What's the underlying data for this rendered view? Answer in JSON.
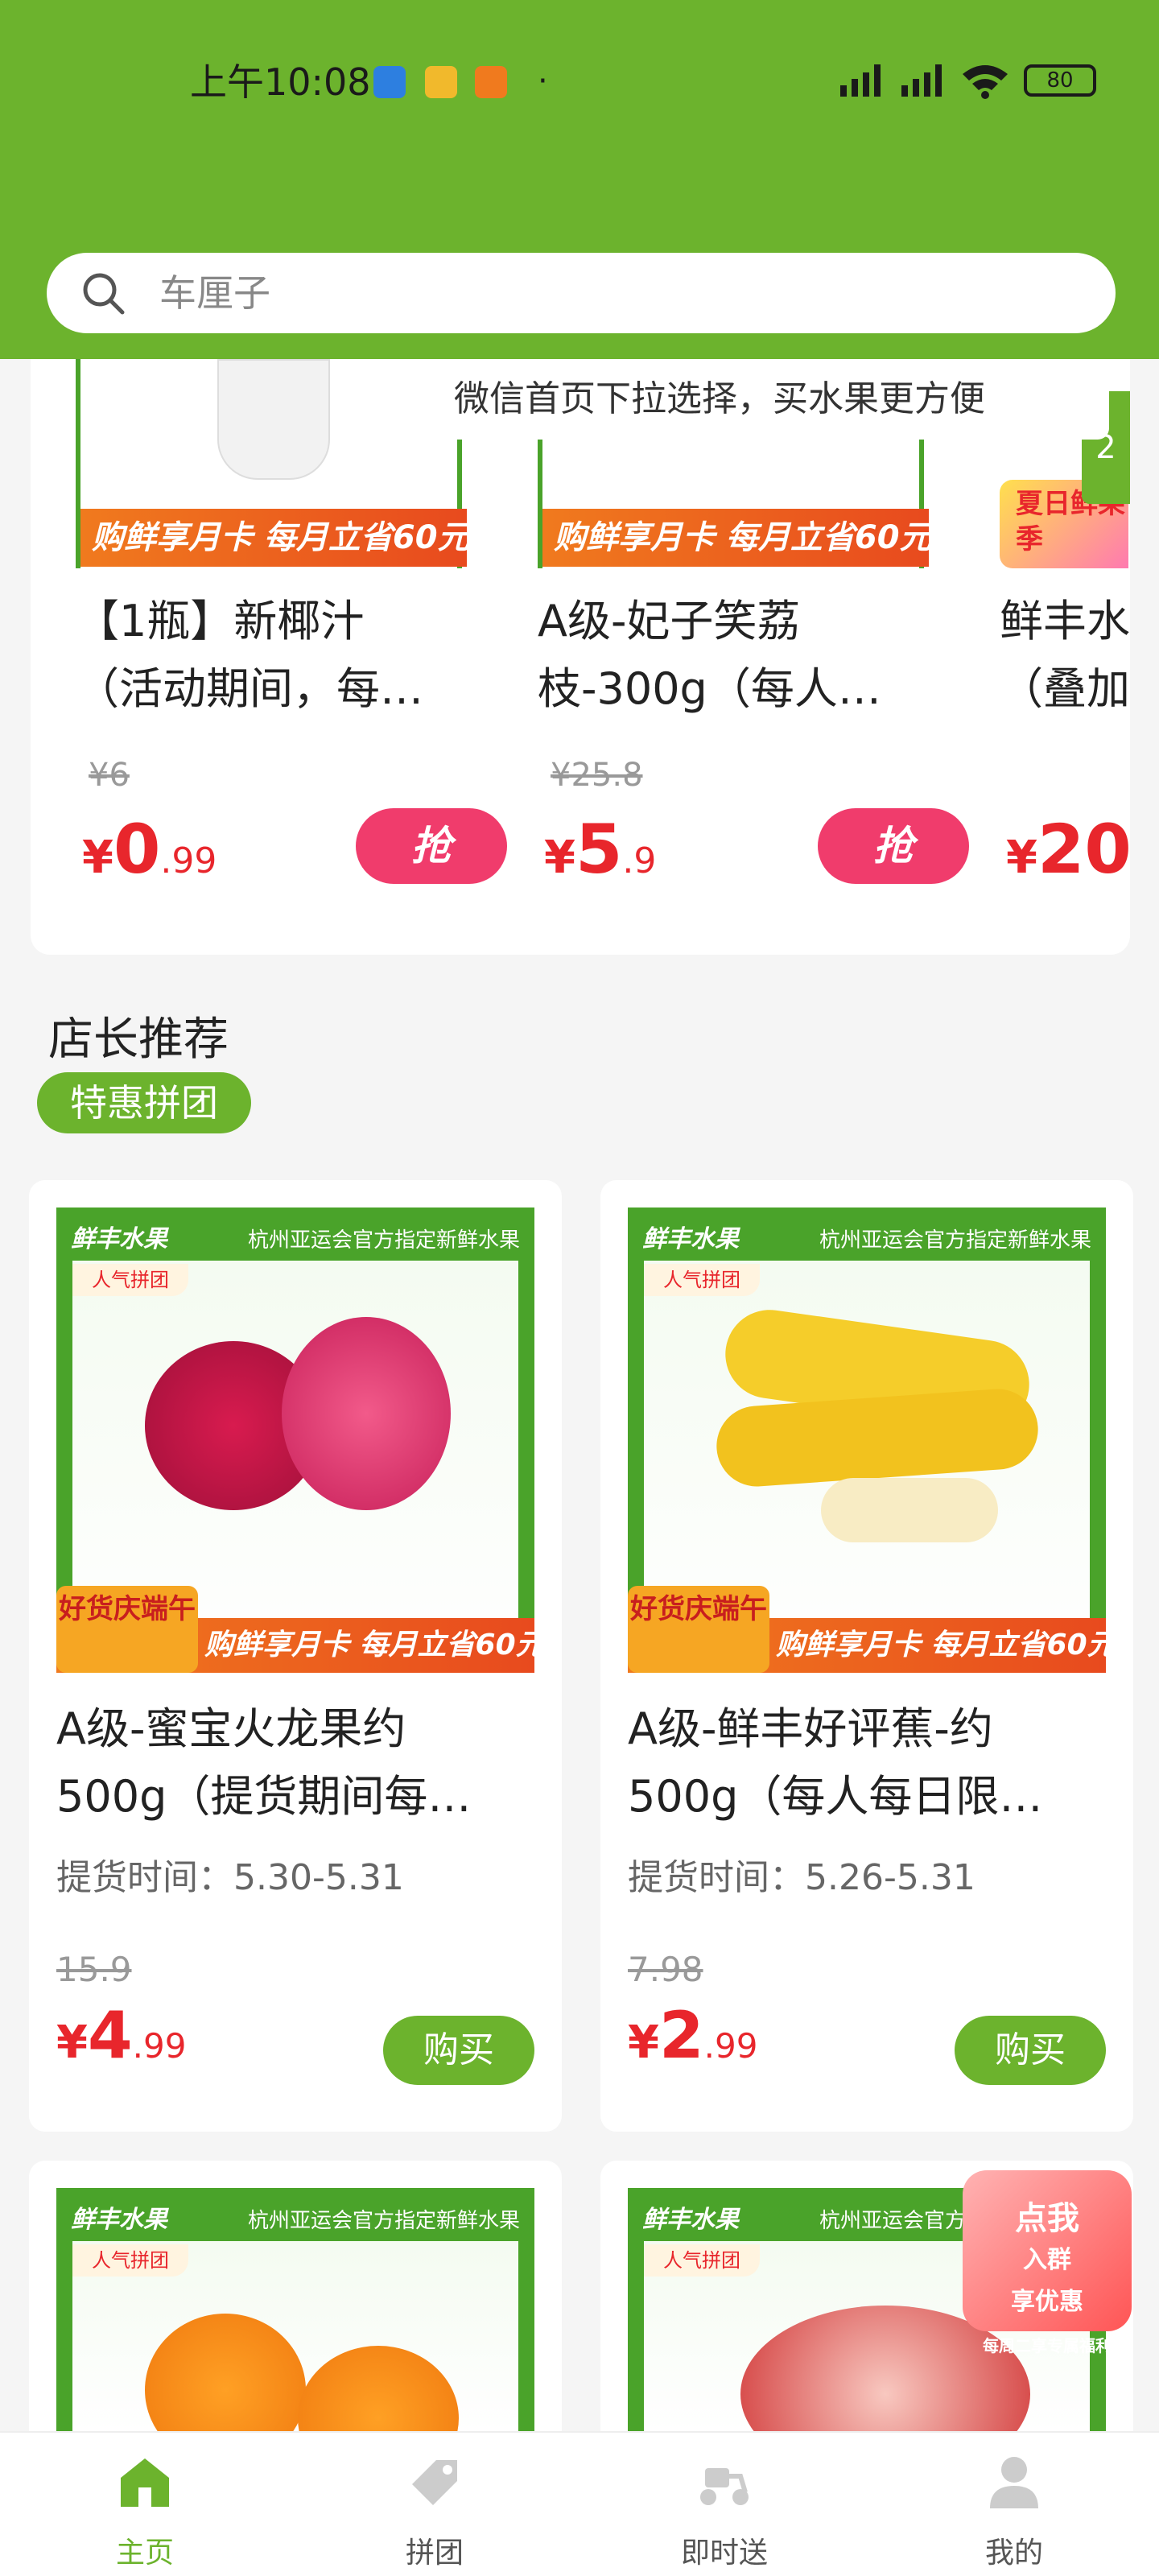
{
  "status_bar": {
    "time": "上午10:08",
    "battery": "80"
  },
  "search": {
    "placeholder": "车厘子"
  },
  "tip": "微信首页下拉选择，买水果更方便",
  "strip_items": [
    {
      "name_line1": "【1瓶】新椰汁",
      "name_line2": "（活动期间，每…",
      "banner": "购鲜享月卡 每月立省60元",
      "original_price": "¥6",
      "price_currency": "¥",
      "price_int": "0",
      "price_dec": ".99",
      "button": "抢"
    },
    {
      "name_line1": "A级-妃子笑荔",
      "name_line2": "枝-300g（每人…",
      "banner": "购鲜享月卡 每月立省60元",
      "original_price": "¥25.8",
      "price_currency": "¥",
      "price_int": "5",
      "price_dec": ".9",
      "button": "抢"
    },
    {
      "name_line1": "鲜丰水",
      "name_line2": "（叠加",
      "badge": "夏日鲜果季",
      "price_currency": "¥",
      "price_int": "20",
      "side_text": "2"
    }
  ],
  "section": {
    "title": "店长推荐",
    "tag": "特惠拼团"
  },
  "products": [
    {
      "brand": "鲜丰水果",
      "slogan": "杭州亚运会官方指定新鲜水果",
      "img_tag": "人气拼团",
      "festival": "好货庆端午",
      "footer": "购鲜享月卡 每月立省60元",
      "name_line1": "A级-蜜宝火龙果约",
      "name_line2": "500g（提货期间每…",
      "pickup": "提货时间：5.30-5.31",
      "original_price": "15.9",
      "price_currency": "¥",
      "price_int": "4",
      "price_dec": ".99",
      "button": "购买"
    },
    {
      "brand": "鲜丰水果",
      "slogan": "杭州亚运会官方指定新鲜水果",
      "img_tag": "人气拼团",
      "festival": "好货庆端午",
      "footer": "购鲜享月卡 每月立省60元",
      "name_line1": "A级-鲜丰好评蕉-约",
      "name_line2": "500g（每人每日限…",
      "pickup": "提货时间：5.26-5.31",
      "original_price": "7.98",
      "price_currency": "¥",
      "price_int": "2",
      "price_dec": ".99",
      "button": "购买"
    },
    {
      "brand": "鲜丰水果",
      "slogan": "杭州亚运会官方指定新鲜水果",
      "img_tag": "人气拼团"
    },
    {
      "brand": "鲜丰水果",
      "slogan": "杭州亚运会官方指定新鲜水果",
      "img_tag": "人气拼团"
    }
  ],
  "float_badge": {
    "line1": "点我",
    "line2": "入群",
    "line3": "享优惠",
    "line4": "每周二享专属福利"
  },
  "bottom_nav": [
    {
      "label": "主页",
      "icon": "home-icon",
      "active": true
    },
    {
      "label": "拼团",
      "icon": "tag-icon",
      "active": false
    },
    {
      "label": "即时送",
      "icon": "scooter-icon",
      "active": false
    },
    {
      "label": "我的",
      "icon": "user-icon",
      "active": false
    }
  ],
  "colors": {
    "brand_green": "#6cb32d",
    "price_red": "#e8262c",
    "grab_pink": "#f03c6c"
  }
}
